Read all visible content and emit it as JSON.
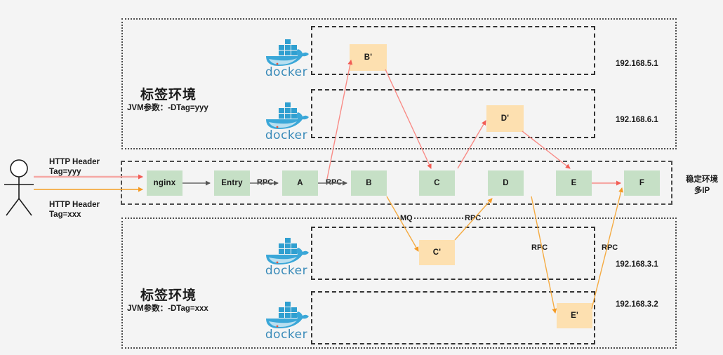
{
  "diagram": {
    "title": "Tag environment routing topology",
    "colors": {
      "stable_node": "#c6e0c6",
      "tag_node": "#fde0b0",
      "tag_yyy_flow": "#f98b86",
      "tag_xxx_flow": "#f5ab42",
      "default_flow": "#666666",
      "background": "#f4f4f4"
    }
  },
  "actor": {
    "name": "user-actor",
    "requests": [
      {
        "id": "req-yyy",
        "line1": "HTTP Header",
        "line2": "Tag=yyy",
        "color": "#f98b86"
      },
      {
        "id": "req-xxx",
        "line1": "HTTP Header",
        "line2": "Tag=xxx",
        "color": "#f5ab42"
      }
    ]
  },
  "top_env": {
    "title": "标签环境",
    "subtitle": "JVM参数：-DTag=yyy",
    "docker_label": "docker",
    "hosts": [
      {
        "ip": "192.168.5.1",
        "nodes": [
          "B'"
        ]
      },
      {
        "ip": "192.168.6.1",
        "nodes": [
          "D'"
        ]
      }
    ]
  },
  "stable_env": {
    "side_label_line1": "稳定环境",
    "side_label_line2": "多IP",
    "nodes": [
      "nginx",
      "Entry",
      "A",
      "B",
      "C",
      "D",
      "E",
      "F"
    ],
    "edge_labels": [
      "RPC",
      "RPC"
    ]
  },
  "bottom_env": {
    "title": "标签环境",
    "subtitle": "JVM参数：-DTag=xxx",
    "docker_label": "docker",
    "hosts": [
      {
        "ip": "192.168.3.1",
        "nodes": [
          "C'"
        ]
      },
      {
        "ip": "192.168.3.2",
        "nodes": [
          "E'"
        ]
      }
    ]
  },
  "flow_labels": {
    "mq": "MQ",
    "rpc_c": "RPC",
    "rpc_e_left": "RPC",
    "rpc_e_right": "RPC"
  }
}
